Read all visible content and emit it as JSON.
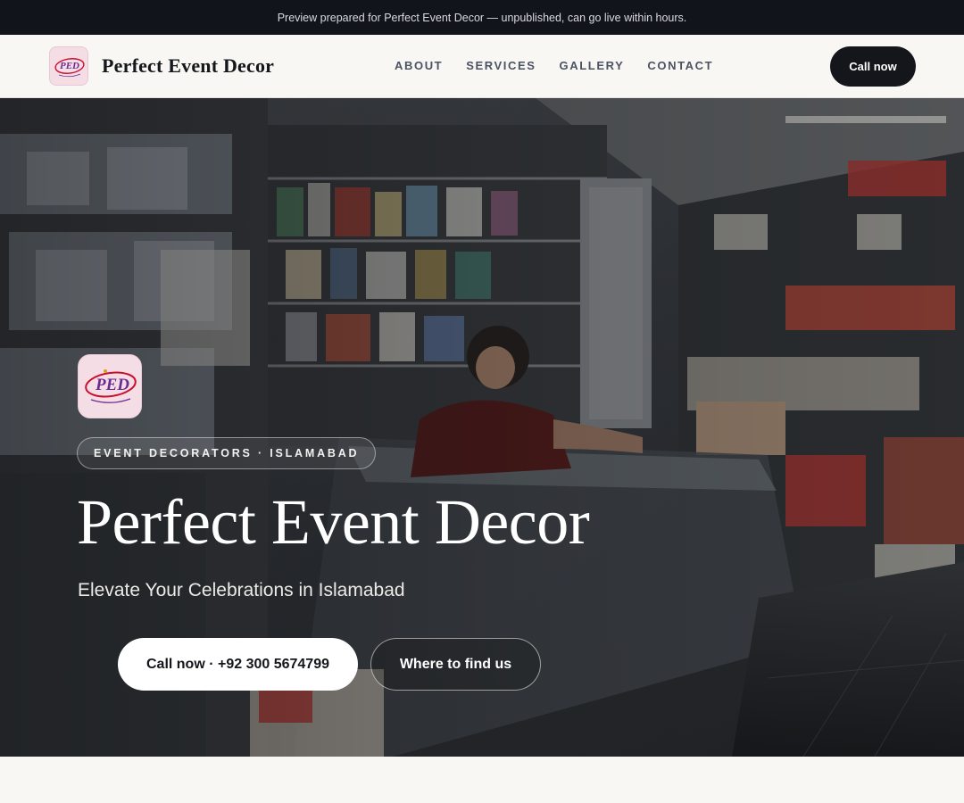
{
  "preview_banner": "Preview prepared for Perfect Event Decor — unpublished, can go live within hours.",
  "header": {
    "logo_icon": "ped-logo-icon",
    "brand_name": "Perfect Event Decor",
    "nav": [
      {
        "label": "ABOUT"
      },
      {
        "label": "SERVICES"
      },
      {
        "label": "GALLERY"
      },
      {
        "label": "CONTACT"
      }
    ],
    "call_button": "Call now"
  },
  "hero": {
    "background": "shop-interior-photo",
    "logo_icon": "ped-logo-icon",
    "logo_text": "PED",
    "tagline": "EVENT DECORATORS · ISLAMABAD",
    "title": "Perfect Event Decor",
    "subtitle": "Elevate Your Celebrations in Islamabad",
    "primary_button": "Call now · +92 300 5674799",
    "secondary_button": "Where to find us"
  },
  "colors": {
    "dark": "#14161b",
    "page_bg": "#f8f7f4",
    "logo_bg": "#f5dde6",
    "logo_red": "#c8102e",
    "logo_purple": "#6a2c91"
  }
}
